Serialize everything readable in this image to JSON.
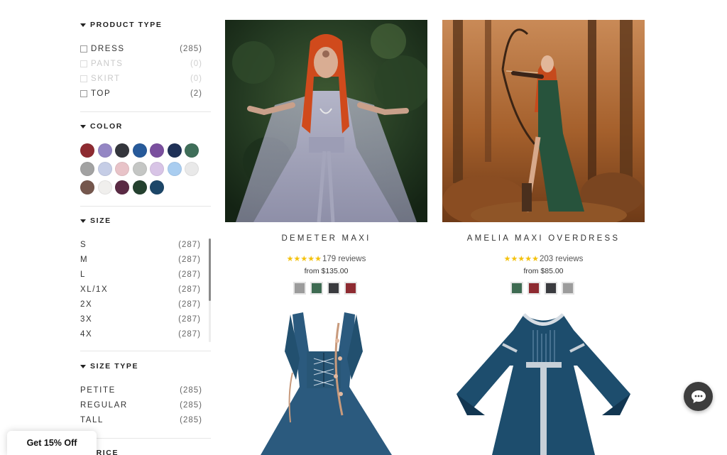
{
  "filters": {
    "product_type": {
      "title": "PRODUCT TYPE",
      "options": [
        {
          "label": "DRESS",
          "count": "(285)",
          "disabled": false
        },
        {
          "label": "PANTS",
          "count": "(0)",
          "disabled": true
        },
        {
          "label": "SKIRT",
          "count": "(0)",
          "disabled": true
        },
        {
          "label": "TOP",
          "count": "(2)",
          "disabled": false
        }
      ]
    },
    "color": {
      "title": "COLOR",
      "swatches": [
        {
          "name": "red",
          "hex": "#8e2b31"
        },
        {
          "name": "lavender",
          "hex": "#9486c4"
        },
        {
          "name": "charcoal",
          "hex": "#34363c"
        },
        {
          "name": "blue",
          "hex": "#275a9a"
        },
        {
          "name": "purple",
          "hex": "#7a4f9e"
        },
        {
          "name": "navy",
          "hex": "#1f3157"
        },
        {
          "name": "green",
          "hex": "#3f6e59"
        },
        {
          "name": "grey",
          "hex": "#a2a2a2"
        },
        {
          "name": "light-blue",
          "hex": "#c5cde6"
        },
        {
          "name": "pink",
          "hex": "#e8c3c8"
        },
        {
          "name": "silver",
          "hex": "#c4c6c4"
        },
        {
          "name": "light-purple",
          "hex": "#d8c4e6"
        },
        {
          "name": "sky",
          "hex": "#a9cdf0"
        },
        {
          "name": "white",
          "hex": "#e9e9e9"
        },
        {
          "name": "brown",
          "hex": "#75574d"
        },
        {
          "name": "ivory",
          "hex": "#f0efed"
        },
        {
          "name": "plum",
          "hex": "#5a2a44"
        },
        {
          "name": "forest",
          "hex": "#24412f"
        },
        {
          "name": "teal-navy",
          "hex": "#1c4668"
        }
      ]
    },
    "size": {
      "title": "SIZE",
      "options": [
        {
          "label": "S",
          "count": "(287)"
        },
        {
          "label": "M",
          "count": "(287)"
        },
        {
          "label": "L",
          "count": "(287)"
        },
        {
          "label": "XL/1X",
          "count": "(287)"
        },
        {
          "label": "2X",
          "count": "(287)"
        },
        {
          "label": "3X",
          "count": "(287)"
        },
        {
          "label": "4X",
          "count": "(287)"
        }
      ]
    },
    "size_type": {
      "title": "SIZE TYPE",
      "options": [
        {
          "label": "PETITE",
          "count": "(285)"
        },
        {
          "label": "REGULAR",
          "count": "(285)"
        },
        {
          "label": "TALL",
          "count": "(285)"
        }
      ]
    },
    "price": {
      "title": "PRICE"
    }
  },
  "products": [
    {
      "name": "DEMETER MAXI",
      "stars": "★★★★★",
      "reviews": "179 reviews",
      "price": "from $135.00",
      "swatches": [
        "#9c9c9c",
        "#3e6b52",
        "#3a3b3f",
        "#8e2b31"
      ]
    },
    {
      "name": "AMELIA MAXI OVERDRESS",
      "stars": "★★★★★",
      "reviews": "203 reviews",
      "price": "from $85.00",
      "swatches": [
        "#3e6b52",
        "#8e2b31",
        "#3a3b3f",
        "#9c9c9c"
      ]
    },
    {
      "name": "",
      "image": "blue-laced-dress"
    },
    {
      "name": "",
      "image": "blue-medieval-dress"
    }
  ],
  "promo": {
    "label": "Get 15% Off"
  },
  "chat": {
    "icon": "chat-bubble-icon"
  }
}
